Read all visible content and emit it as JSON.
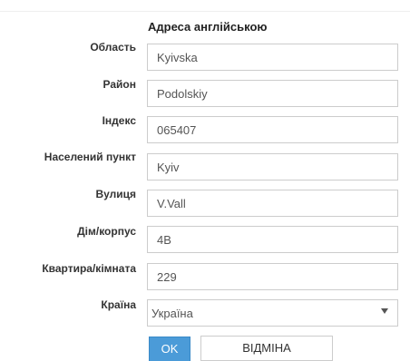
{
  "section": {
    "title": "Адреса англійською"
  },
  "fields": [
    {
      "label": "Область",
      "value": "Kyivska"
    },
    {
      "label": "Район",
      "value": "Podolskiy"
    },
    {
      "label": "Індекс",
      "value": "065407"
    },
    {
      "label": "Населений пункт",
      "value": "Kyiv"
    },
    {
      "label": "Вулиця",
      "value": "V.Vall"
    },
    {
      "label": "Дім/корпус",
      "value": "4В"
    },
    {
      "label": "Квартира/кімната",
      "value": "229"
    }
  ],
  "country": {
    "label": "Країна",
    "selected": "Україна"
  },
  "actions": {
    "ok_label": "OK",
    "cancel_label": "ВІДМІНА"
  },
  "colors": {
    "primary": "#4b9bd8",
    "border": "#cccccc",
    "label_text": "#333333",
    "field_text": "#555555"
  }
}
